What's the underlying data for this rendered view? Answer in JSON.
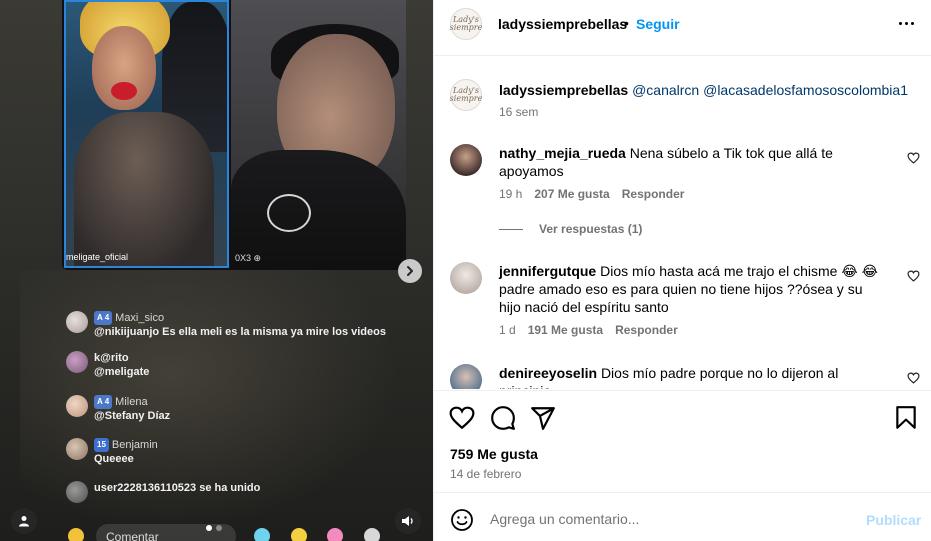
{
  "media": {
    "left_cam_tag": "meligate_oficial",
    "right_cam_tag": "0X3 ⊕",
    "chat": [
      {
        "badge": "A 4",
        "name": "Maxi_sico",
        "text": "@nikiijuanjo Es ella meli es la misma ya mire los videos"
      },
      {
        "badge": "",
        "name": "k@rito",
        "text": "@meligate"
      },
      {
        "badge": "A 4",
        "name": "Milena",
        "text": "@Stefany Díaz"
      },
      {
        "badge": "15",
        "name": "Benjamin",
        "text": "Queeee"
      },
      {
        "badge": "",
        "name": "",
        "text": "user2228136110523 se ha unido"
      }
    ],
    "comment_pill": "Comentar"
  },
  "header": {
    "username": "ladyssiemprebellas",
    "separator": "•",
    "follow_label": "Seguir"
  },
  "caption": {
    "username": "ladyssiemprebellas",
    "mention1": "@canalrcn",
    "mention2": "@lacasadelosfamososcolombia1",
    "time": "16 sem"
  },
  "comments": [
    {
      "username": "nathy_mejia_rueda",
      "text": "Nena súbelo a Tik tok que allá te apoyamos",
      "time": "19 h",
      "likes": "207 Me gusta",
      "reply_label": "Responder",
      "view_replies": "Ver respuestas (1)"
    },
    {
      "username": "jennifergutque",
      "text": "Dios mío hasta acá me trajo el chisme 😂 😂 padre amado eso es para quien no tiene hijos ??ósea y su hijo nació del espíritu santo",
      "time": "1 d",
      "likes": "191 Me gusta",
      "reply_label": "Responder"
    },
    {
      "username": "denireeyoselin",
      "text": "Dios mío padre porque no lo dijeron al principio"
    }
  ],
  "actions": {
    "likes": "759 Me gusta",
    "date": "14 de febrero"
  },
  "add_comment": {
    "placeholder": "Agrega un comentario...",
    "post_label": "Publicar"
  },
  "colors": {
    "accent": "#0095f6",
    "mention": "#00376b",
    "muted": "#737373",
    "post_disabled": "#b3dbff"
  }
}
